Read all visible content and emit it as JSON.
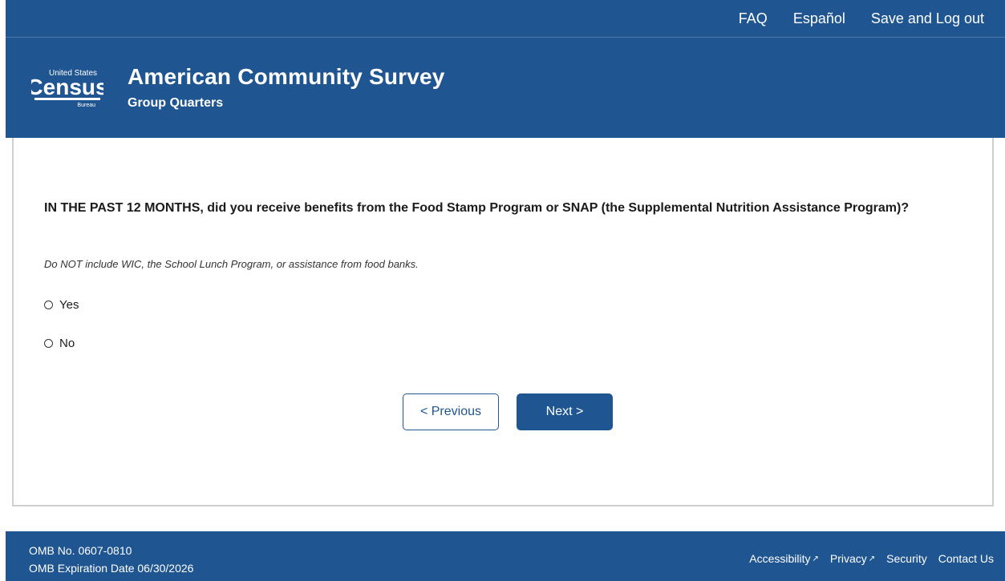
{
  "topnav": {
    "faq": "FAQ",
    "espanol": "Español",
    "logout": "Save and Log out"
  },
  "logo": {
    "line1": "United States",
    "line2": "Census",
    "line3": "Bureau"
  },
  "header": {
    "title": "American Community Survey",
    "subtitle": "Group Quarters"
  },
  "question": {
    "text": "IN THE PAST 12 MONTHS, did you receive benefits from the Food Stamp Program or SNAP (the Supplemental Nutrition Assistance Program)?",
    "instruction": "Do NOT include WIC, the School Lunch Program, or assistance from food banks.",
    "options": [
      "Yes",
      "No"
    ]
  },
  "buttons": {
    "previous": "< Previous",
    "next": "Next >"
  },
  "footer": {
    "omb_number": "OMB No. 0607-0810",
    "omb_expiration": "OMB Expiration Date 06/30/2026",
    "links": [
      "Accessibility",
      "Privacy",
      "Security",
      "Contact Us"
    ]
  },
  "colors": {
    "brand_blue": "#1f5591",
    "panel_border": "#cfcfcf"
  },
  "icons": {
    "external_link": "external-link-icon"
  }
}
